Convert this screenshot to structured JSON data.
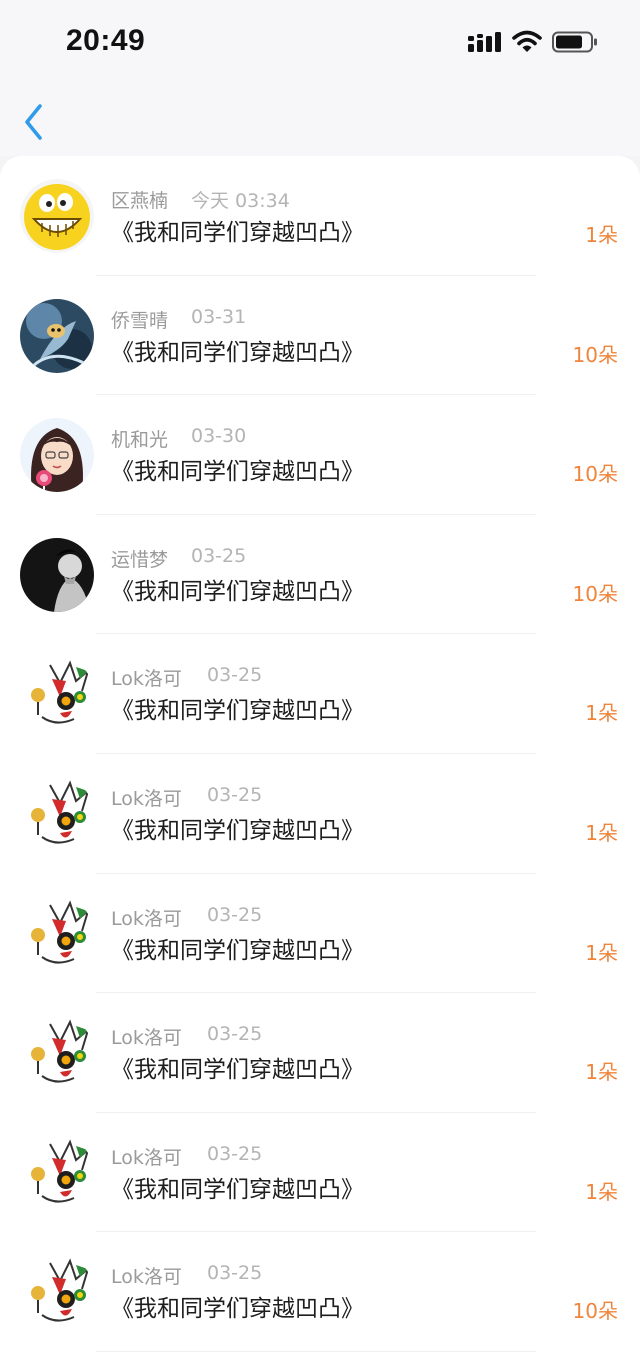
{
  "status_bar": {
    "time": "20:49"
  },
  "items": [
    {
      "name": "区燕楠",
      "date": "今天 03:34",
      "title": "《我和同学们穿越凹凸》",
      "count": "1朵",
      "avatar": "smiley-avatar"
    },
    {
      "name": "侨雪晴",
      "date": "03-31",
      "title": "《我和同学们穿越凹凸》",
      "count": "10朵",
      "avatar": "game-character-avatar"
    },
    {
      "name": "机和光",
      "date": "03-30",
      "title": "《我和同学们穿越凹凸》",
      "count": "10朵",
      "avatar": "anime-girl-avatar"
    },
    {
      "name": "运惜梦",
      "date": "03-25",
      "title": "《我和同学们穿越凹凸》",
      "count": "10朵",
      "avatar": "portrait-avatar"
    },
    {
      "name": "Lok洛可",
      "date": "03-25",
      "title": "《我和同学们穿越凹凸》",
      "count": "1朵",
      "avatar": "cartoon-cat-avatar"
    },
    {
      "name": "Lok洛可",
      "date": "03-25",
      "title": "《我和同学们穿越凹凸》",
      "count": "1朵",
      "avatar": "cartoon-cat-avatar"
    },
    {
      "name": "Lok洛可",
      "date": "03-25",
      "title": "《我和同学们穿越凹凸》",
      "count": "1朵",
      "avatar": "cartoon-cat-avatar"
    },
    {
      "name": "Lok洛可",
      "date": "03-25",
      "title": "《我和同学们穿越凹凸》",
      "count": "1朵",
      "avatar": "cartoon-cat-avatar"
    },
    {
      "name": "Lok洛可",
      "date": "03-25",
      "title": "《我和同学们穿越凹凸》",
      "count": "1朵",
      "avatar": "cartoon-cat-avatar"
    },
    {
      "name": "Lok洛可",
      "date": "03-25",
      "title": "《我和同学们穿越凹凸》",
      "count": "10朵",
      "avatar": "cartoon-cat-avatar"
    }
  ],
  "colors": {
    "accent_count": "#f0843b",
    "back_arrow": "#2f9bea",
    "name_gray": "#9a9a9a",
    "date_gray": "#b4b4b4"
  }
}
